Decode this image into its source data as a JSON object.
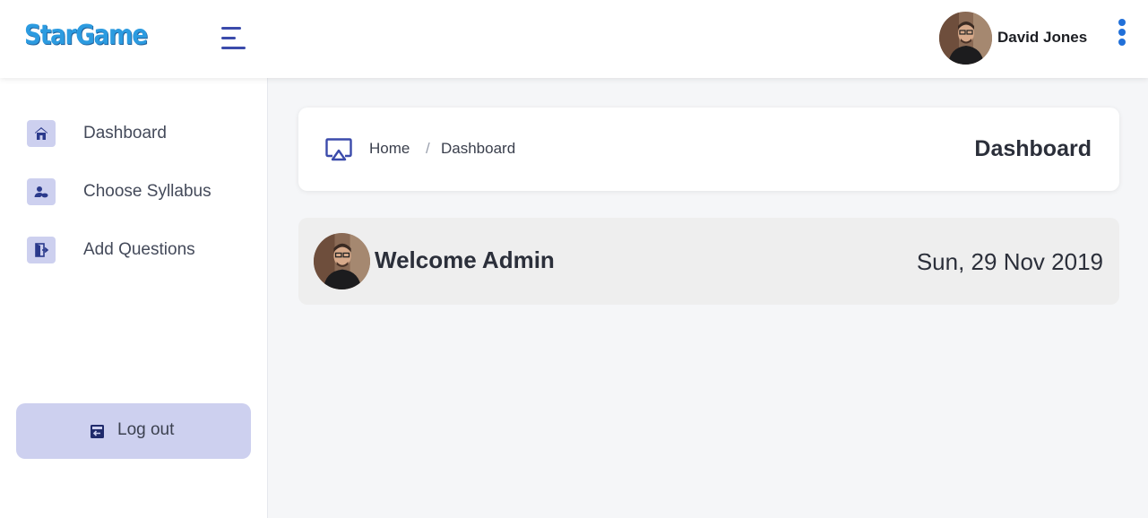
{
  "header": {
    "logo": "StarGame",
    "menu_icon": "hamburger-menu-icon",
    "user_name": "David Jones",
    "more_icon": "vertical-dots-icon"
  },
  "sidebar": {
    "items": [
      {
        "label": "Dashboard",
        "icon": "home-icon"
      },
      {
        "label": "Choose Syllabus",
        "icon": "user-cloud-icon"
      },
      {
        "label": "Add Questions",
        "icon": "door-exit-icon"
      }
    ],
    "logout": {
      "label": "Log out",
      "icon": "logout-door-icon"
    }
  },
  "breadcrumb": {
    "icon": "airplay-icon",
    "home": "Home",
    "separator": "/",
    "current": "Dashboard",
    "page_title": "Dashboard"
  },
  "welcome": {
    "text": "Welcome Admin",
    "date": "Sun, 29 Nov 2019"
  },
  "colors": {
    "accent": "#3b4bab",
    "logo_blue": "#2c9be0",
    "nav_icon_bg": "#cdd0ef",
    "kebab_blue": "#2170d9",
    "page_bg": "#f5f6f8",
    "welcome_bg": "#eeeeee"
  }
}
